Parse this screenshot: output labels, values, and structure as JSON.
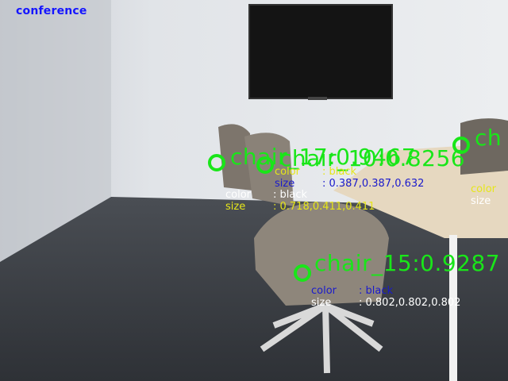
{
  "scene_label": "conference",
  "detections": [
    {
      "title": "chair_17:0.9467",
      "color_key": "color",
      "color_value": ": black",
      "size_key": "size",
      "size_value": ": 0.718,0.411,0.411"
    },
    {
      "title": "chair_10:0.8256",
      "color_key": "color",
      "color_value": ": black",
      "size_key": "size",
      "size_value": ": 0.387,0.387,0.632"
    },
    {
      "title": "ch",
      "color_key": "color",
      "size_key": "size"
    },
    {
      "title": "chair_15:0.9287",
      "color_key": "color",
      "color_value": ": black",
      "size_key": "size",
      "size_value": ": 0.802,0.802,0.802"
    }
  ],
  "colors": {
    "detection_green": "#19e619",
    "text_white": "#ffffff",
    "text_yellow": "#e6e619",
    "text_blue": "#1a1acc",
    "label_blue": "#1515ff"
  }
}
